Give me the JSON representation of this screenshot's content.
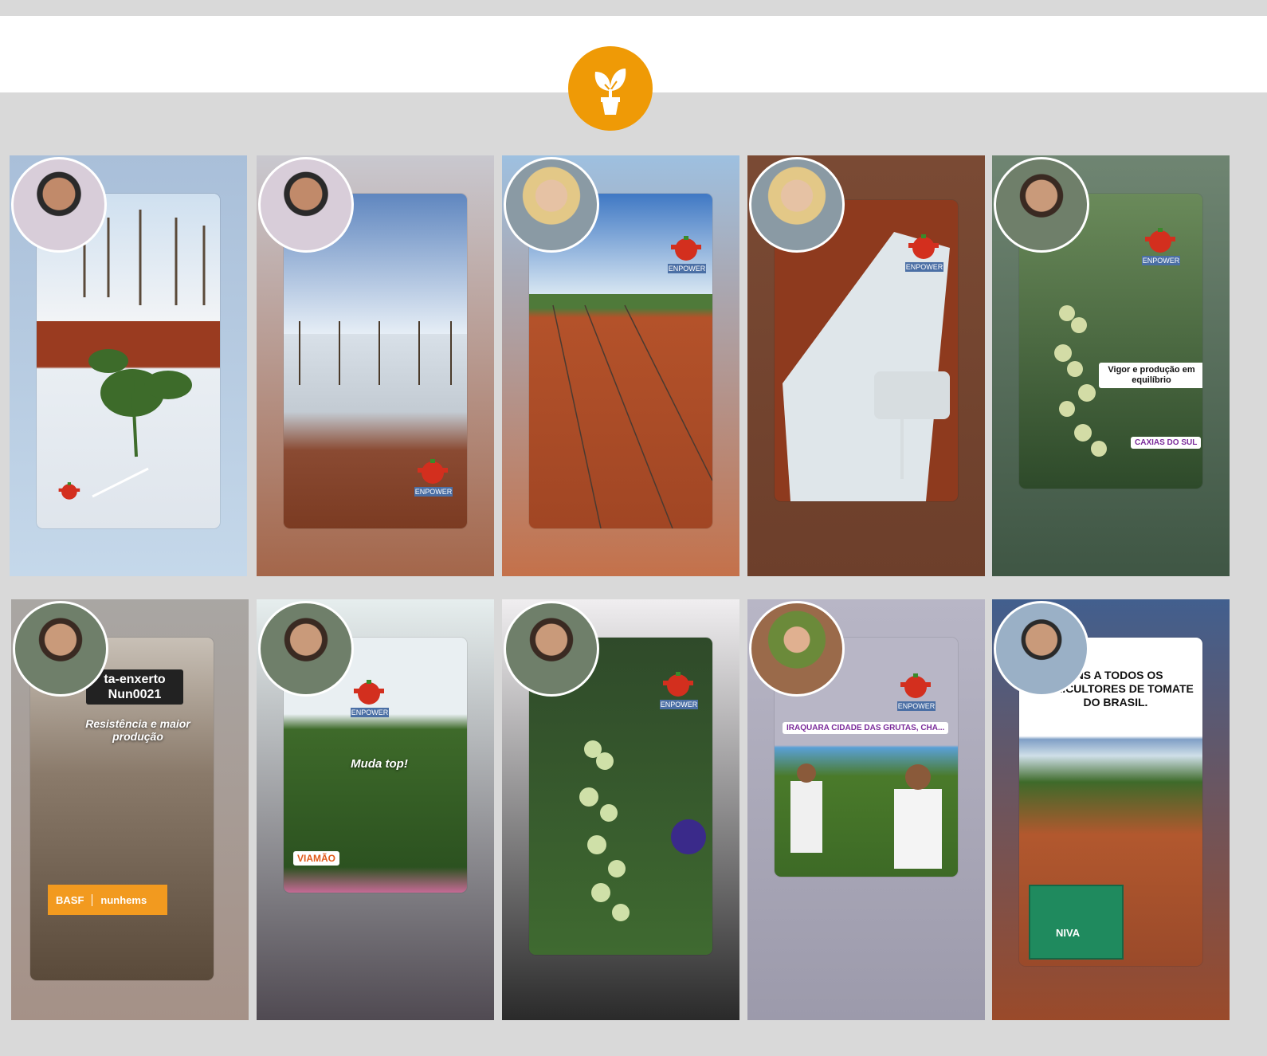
{
  "brand": {
    "logo_icon": "sprout-pot-icon",
    "accent": "#ef9a06"
  },
  "stories": [
    {
      "id": 1,
      "avatar": "man-sunglasses",
      "bg": [
        "#a9bfd9",
        "#c5d8ea"
      ],
      "overlay": "",
      "badge_label": "",
      "location": ""
    },
    {
      "id": 2,
      "avatar": "man-sunglasses",
      "bg": [
        "#c9c8cf",
        "#a4664a"
      ],
      "overlay": "",
      "badge_label": "ENPOWER",
      "location": ""
    },
    {
      "id": 3,
      "avatar": "woman-blonde",
      "bg": [
        "#9ec0e0",
        "#c4714a"
      ],
      "overlay": "",
      "badge_label": "ENPOWER",
      "location": ""
    },
    {
      "id": 4,
      "avatar": "woman-blonde",
      "bg": [
        "#7a4a34",
        "#6d3f2b"
      ],
      "overlay": "",
      "badge_label": "ENPOWER",
      "location": ""
    },
    {
      "id": 5,
      "avatar": "man-smiling",
      "bg": [
        "#6f8572",
        "#3f5644"
      ],
      "overlay": "Vigor e produção em equilíbrio",
      "badge_label": "ENPOWER",
      "location": "CAXIAS DO SUL"
    },
    {
      "id": 6,
      "avatar": "man-smiling",
      "bg": [
        "#a9a6a3",
        "#a59187"
      ],
      "overlay": "Resistência e maior produção",
      "headline": "ta-enxerto Nun0021",
      "badge_label": "",
      "location": "",
      "basf": "BASF",
      "basf_partner": "nunhems"
    },
    {
      "id": 7,
      "avatar": "man-smiling",
      "bg": [
        "#e6eeee",
        "#504a52"
      ],
      "overlay": "Muda top!",
      "badge_label": "ENPOWER",
      "location": "VIAMÃO"
    },
    {
      "id": 8,
      "avatar": "man-smiling",
      "bg": [
        "#f0eef0",
        "#2a2a2a"
      ],
      "overlay": "",
      "badge_label": "ENPOWER",
      "location": ""
    },
    {
      "id": 9,
      "avatar": "family-runners",
      "bg": [
        "#b8b6c6",
        "#9c9aab"
      ],
      "overlay": "",
      "badge_label": "ENPOWER",
      "location": "IRAQUARA CIDADE DAS GRUTAS, CHA..."
    },
    {
      "id": 10,
      "avatar": "man-short-hair",
      "bg": [
        "#425f8e",
        "#9a4a2a"
      ],
      "overlay": "ENS A TODOS OS AGRICULTORES DE TOMATE DO BRASIL.",
      "badge_label": "",
      "location": "",
      "crate_label": "NIVA"
    }
  ]
}
